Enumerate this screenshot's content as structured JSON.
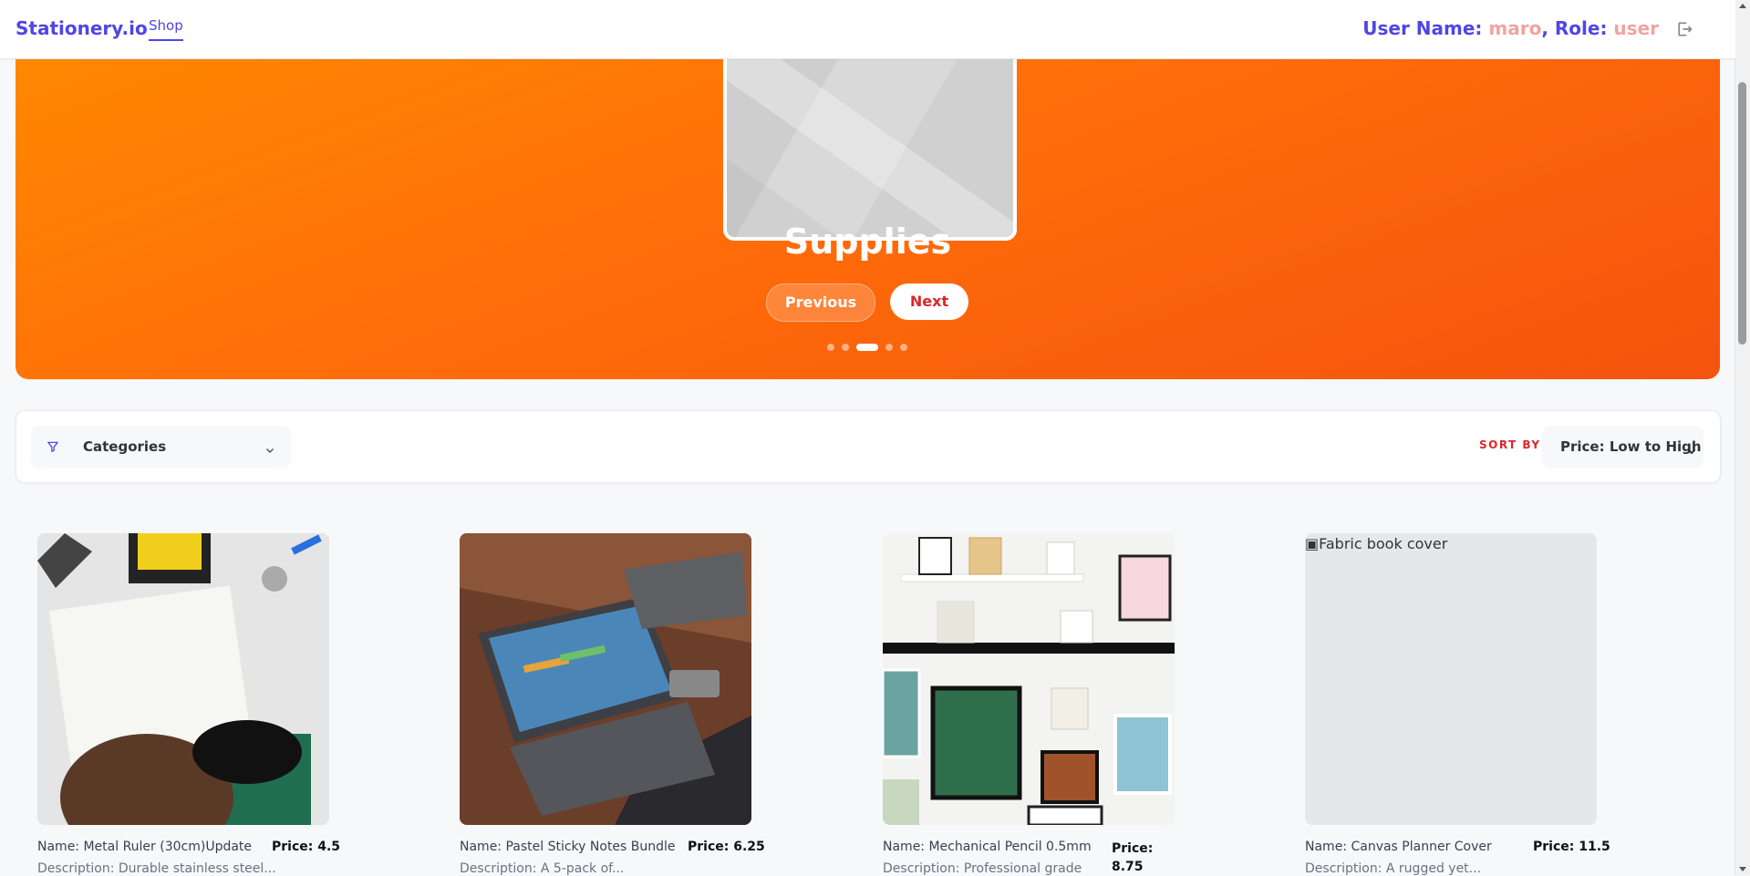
{
  "navbar": {
    "brand": "Stationery.io",
    "shop_link": "Shop",
    "user_name_label": "User Name: ",
    "user_name_value": "maro",
    "role_label": ", Role: ",
    "role_value": "user",
    "logout_icon": "logout-icon"
  },
  "hero": {
    "title": "Supplies",
    "prev_label": "Previous",
    "next_label": "Next",
    "slide_count": 5,
    "active_slide": 3
  },
  "filters": {
    "categories_label": "Categories",
    "sort_by_label": "SORT BY",
    "sort_value": "Price: Low to High"
  },
  "products": [
    {
      "name": "Name: Metal Ruler (30cm)Update",
      "price": "Price: 4.5",
      "description": "Description: Durable stainless steel..."
    },
    {
      "name": "Name: Pastel Sticky Notes Bundle",
      "price": "Price: 6.25",
      "description": "Description: A 5-pack of..."
    },
    {
      "name": "Name: Mechanical Pencil 0.5mm",
      "price_line1": "Price:",
      "price_line2": "8.75",
      "description": "Description: Professional grade"
    },
    {
      "name": "Name: Canvas Planner Cover",
      "price": "Price: 11.5",
      "description": "Description: A rugged yet...",
      "image_alt": "Fabric book cover"
    }
  ],
  "colors": {
    "brand": "#4f46e5",
    "accent_red": "#dc2626",
    "hero_orange": "#ff6c0a",
    "user_value": "#f0a4a0"
  }
}
